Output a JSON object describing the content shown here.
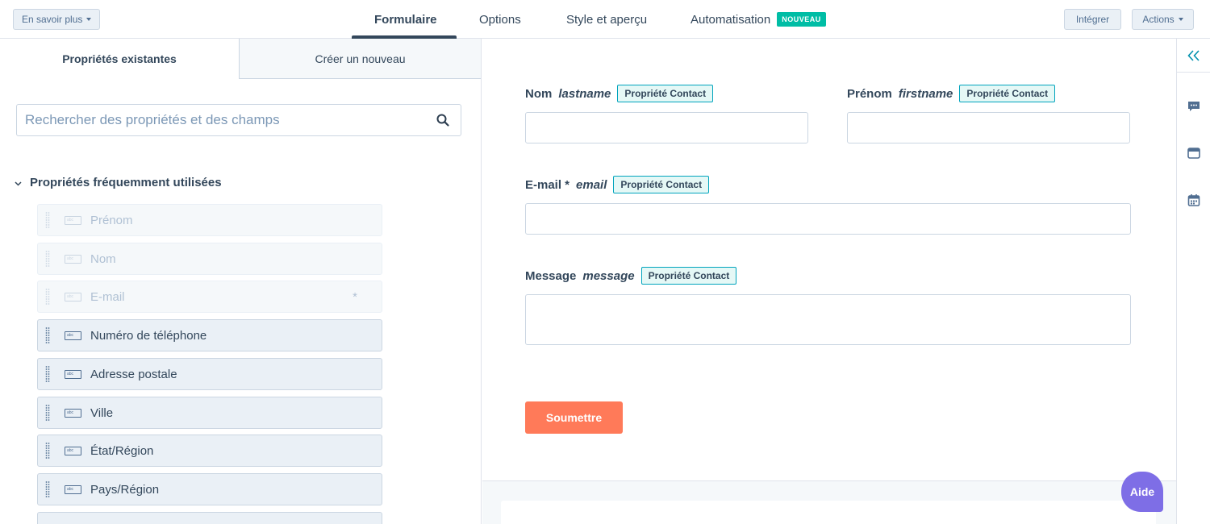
{
  "topbar": {
    "learn_more": "En savoir plus",
    "tabs": [
      "Formulaire",
      "Options",
      "Style et aperçu",
      "Automatisation"
    ],
    "new_badge": "NOUVEAU",
    "embed": "Intégrer",
    "actions": "Actions"
  },
  "left": {
    "tabs": [
      "Propriétés existantes",
      "Créer un nouveau"
    ],
    "search_placeholder": "Rechercher des propriétés et des champs",
    "section_title": "Propriétés fréquemment utilisées",
    "field_icon_text": "abc",
    "properties": [
      {
        "label": "Prénom",
        "state": "in-form"
      },
      {
        "label": "Nom",
        "state": "in-form"
      },
      {
        "label": "E-mail",
        "state": "in-form",
        "required_mark": "*"
      },
      {
        "label": "Numéro de téléphone",
        "state": "available"
      },
      {
        "label": "Adresse postale",
        "state": "available"
      },
      {
        "label": "Ville",
        "state": "available"
      },
      {
        "label": "État/Région",
        "state": "available"
      },
      {
        "label": "Pays/Région",
        "state": "available"
      }
    ]
  },
  "form": {
    "fields": [
      {
        "label": "Nom",
        "internal": "lastname",
        "tag": "Propriété Contact"
      },
      {
        "label": "Prénom",
        "internal": "firstname",
        "tag": "Propriété Contact"
      },
      {
        "label": "E-mail *",
        "internal": "email",
        "tag": "Propriété Contact"
      },
      {
        "label": "Message",
        "internal": "message",
        "tag": "Propriété Contact"
      }
    ],
    "submit": "Soumettre"
  },
  "help": "Aide",
  "colors": {
    "accent": "#ff7a59",
    "tag_border": "#00a4bd",
    "help": "#7e6ee6",
    "new_badge": "#00bda5"
  }
}
